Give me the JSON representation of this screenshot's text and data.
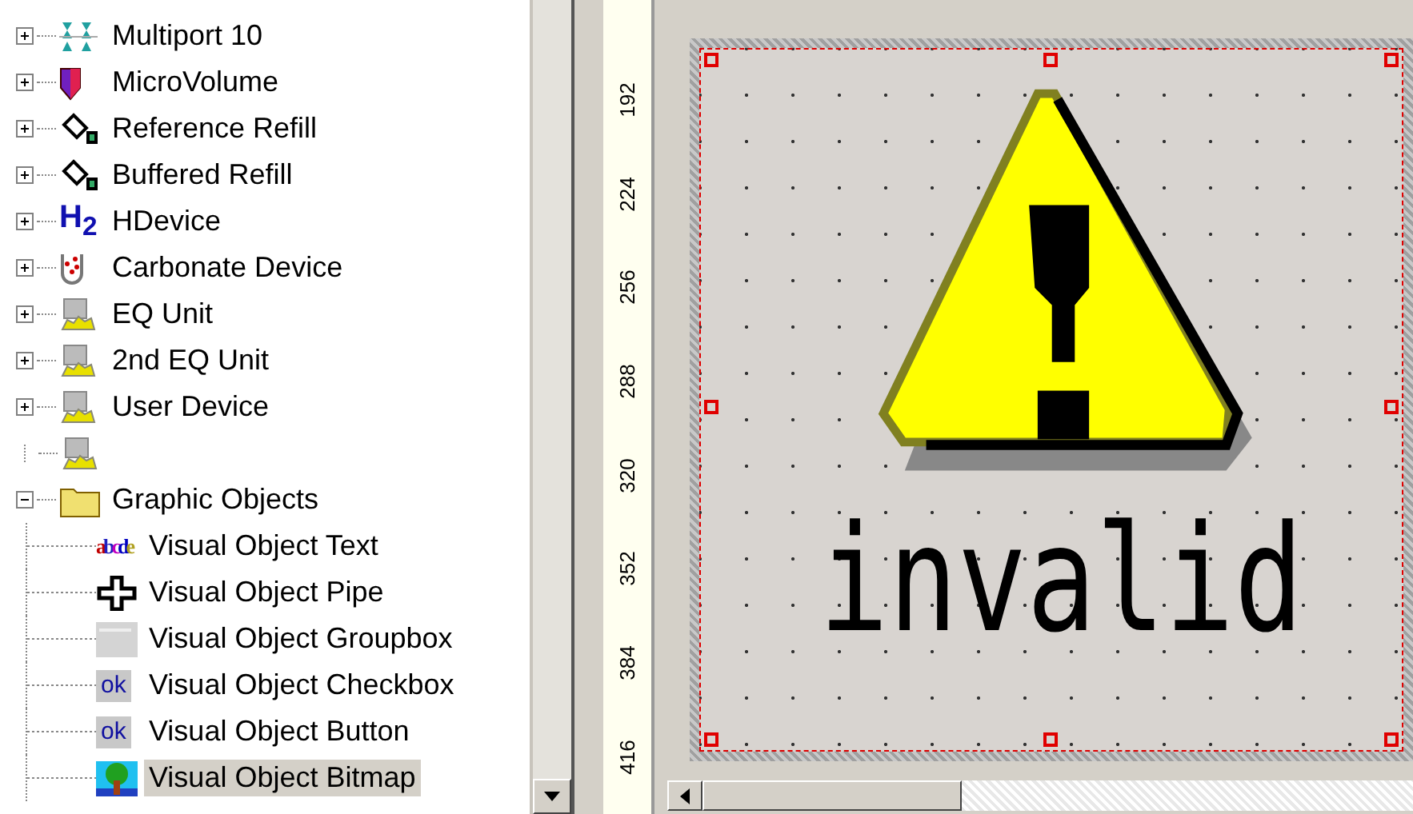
{
  "tree": {
    "items": [
      {
        "label": "Multiport 10",
        "kind": "multiport",
        "expanded": false
      },
      {
        "label": "MicroVolume",
        "kind": "microvolume",
        "expanded": false
      },
      {
        "label": "Reference Refill",
        "kind": "refill",
        "expanded": false
      },
      {
        "label": "Buffered Refill",
        "kind": "refill",
        "expanded": false
      },
      {
        "label": "HDevice",
        "kind": "formula",
        "icon_text": "H$_{2}$",
        "expanded": false
      },
      {
        "label": "Carbonate Device",
        "kind": "carbonate",
        "expanded": false
      },
      {
        "label": "EQ Unit",
        "kind": "unit",
        "expanded": false
      },
      {
        "label": "2nd EQ Unit",
        "kind": "unit",
        "expanded": false
      },
      {
        "label": "User Device",
        "kind": "unit",
        "expanded": false
      },
      {
        "kind": "unit"
      },
      {
        "label": "Graphic Objects",
        "kind": "folder",
        "expanded": true,
        "children": [
          {
            "label": "Visual Object Text",
            "kind": "letters",
            "icon_text": "abcde",
            "selected": false
          },
          {
            "label": "Visual Object Pipe",
            "kind": "pipe",
            "selected": false
          },
          {
            "label": "Visual Object Groupbox",
            "kind": "groupbox",
            "selected": false
          },
          {
            "label": "Visual Object Checkbox",
            "kind": "ok",
            "icon_text": "ok",
            "selected": false
          },
          {
            "label": "Visual Object Button",
            "kind": "ok",
            "icon_text": "ok",
            "selected": false
          },
          {
            "label": "Visual Object Bitmap",
            "kind": "bitmap",
            "selected": true
          }
        ]
      }
    ]
  },
  "ruler": {
    "labels": [
      "192",
      "224",
      "256",
      "288",
      "320",
      "352",
      "384",
      "416"
    ]
  },
  "canvas": {
    "bitmap": {
      "caption": "invalid",
      "selected": true
    }
  }
}
